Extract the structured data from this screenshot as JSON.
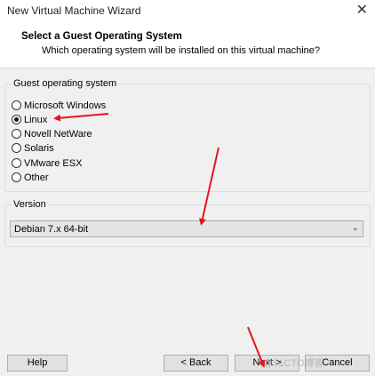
{
  "window": {
    "title": "New Virtual Machine Wizard"
  },
  "header": {
    "title": "Select a Guest Operating System",
    "subtitle": "Which operating system will be installed on this virtual machine?"
  },
  "guest_os": {
    "legend": "Guest operating system",
    "options": [
      "Microsoft Windows",
      "Linux",
      "Novell NetWare",
      "Solaris",
      "VMware ESX",
      "Other"
    ],
    "selected": "Linux"
  },
  "version": {
    "legend": "Version",
    "selected": "Debian 7.x 64-bit"
  },
  "buttons": {
    "help": "Help",
    "back": "< Back",
    "next": "Next >",
    "cancel": "Cancel"
  },
  "watermark": "@51CTO博客",
  "colors": {
    "annotation_arrow": "#e8141b"
  }
}
